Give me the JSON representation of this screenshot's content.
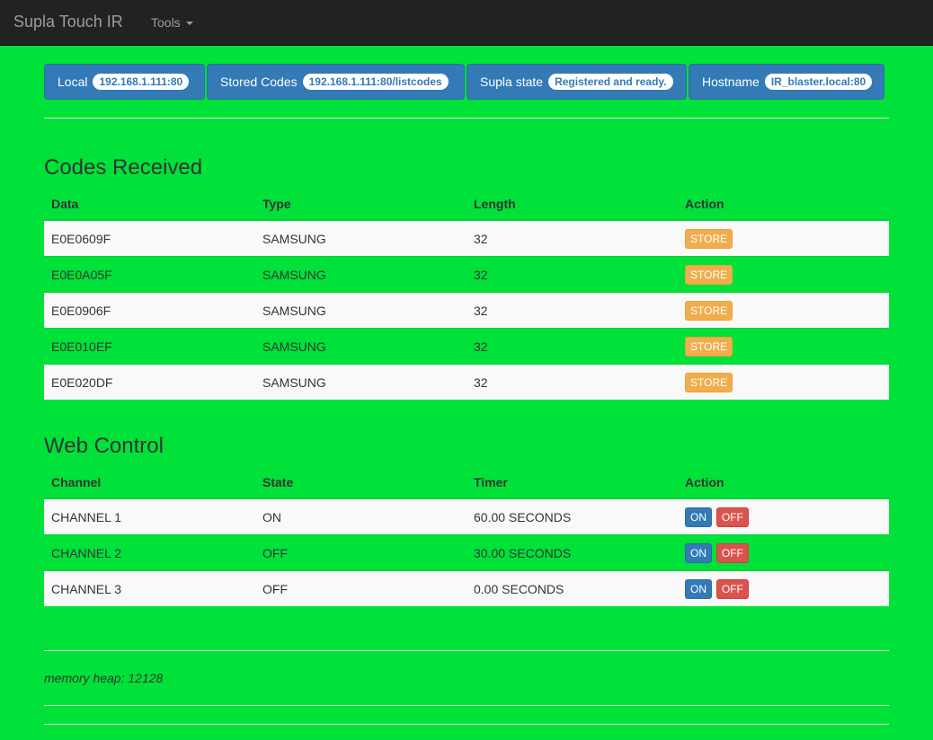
{
  "navbar": {
    "brand": "Supla Touch IR",
    "tools_label": "Tools"
  },
  "info_buttons": [
    {
      "label": "Local",
      "badge": "192.168.1.111:80"
    },
    {
      "label": "Stored Codes",
      "badge": "192.168.1.111:80/listcodes"
    },
    {
      "label": "Supla state",
      "badge": "Registered and ready."
    },
    {
      "label": "Hostname",
      "badge": "IR_blaster.local:80"
    }
  ],
  "codes": {
    "title": "Codes Received",
    "headers": [
      "Data",
      "Type",
      "Length",
      "Action"
    ],
    "rows": [
      {
        "data": "E0E0609F",
        "type": "SAMSUNG",
        "length": "32",
        "action": "STORE"
      },
      {
        "data": "E0E0A05F",
        "type": "SAMSUNG",
        "length": "32",
        "action": "STORE"
      },
      {
        "data": "E0E0906F",
        "type": "SAMSUNG",
        "length": "32",
        "action": "STORE"
      },
      {
        "data": "E0E010EF",
        "type": "SAMSUNG",
        "length": "32",
        "action": "STORE"
      },
      {
        "data": "E0E020DF",
        "type": "SAMSUNG",
        "length": "32",
        "action": "STORE"
      }
    ]
  },
  "web_control": {
    "title": "Web Control",
    "headers": [
      "Channel",
      "State",
      "Timer",
      "Action"
    ],
    "rows": [
      {
        "channel": "CHANNEL 1",
        "state": "ON",
        "timer": "60.00 SECONDS",
        "on": "ON",
        "off": "OFF"
      },
      {
        "channel": "CHANNEL 2",
        "state": "OFF",
        "timer": "30.00 SECONDS",
        "on": "ON",
        "off": "OFF"
      },
      {
        "channel": "CHANNEL 3",
        "state": "OFF",
        "timer": "0.00 SECONDS",
        "on": "ON",
        "off": "OFF"
      }
    ]
  },
  "footer": {
    "memory": "memory heap: 12128"
  },
  "colors": {
    "page_background": "#00e13a",
    "navbar": "#222222",
    "primary": "#337ab7",
    "warning": "#f0ad4e",
    "danger": "#d9534f"
  }
}
